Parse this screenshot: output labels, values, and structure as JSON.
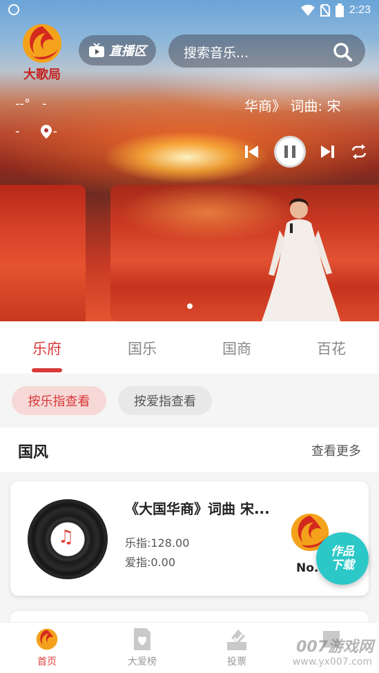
{
  "status_bar": {
    "time": "2:23"
  },
  "header": {
    "logo_text": "大歌局",
    "live_label": "直播区",
    "search_placeholder": "搜索音乐..."
  },
  "weather": {
    "temp": "--°",
    "temp_dash": "-",
    "line2_left": "-",
    "location": "-"
  },
  "now_playing": {
    "marquee": "华商》 词曲: 宋"
  },
  "banner": {
    "active_index": 1
  },
  "tabs": [
    {
      "label": "乐府"
    },
    {
      "label": "国乐"
    },
    {
      "label": "国商"
    },
    {
      "label": "百花"
    }
  ],
  "filters": {
    "by_music": "按乐指查看",
    "by_love": "按爱指查看"
  },
  "section": {
    "title": "国风",
    "more": "查看更多"
  },
  "song_card": {
    "title": "《大国华商》词曲 宋...",
    "music_index": "乐指:128.00",
    "love_index": "爱指:0.00",
    "rank": "No.1"
  },
  "fab": {
    "line1": "作品",
    "line2": "下载"
  },
  "bottom_nav": [
    {
      "label": "首页"
    },
    {
      "label": "大爱榜"
    },
    {
      "label": "投票"
    },
    {
      "label": ""
    }
  ],
  "watermark": {
    "text": "007游戏网",
    "url": "www.yx007.com"
  },
  "colors": {
    "accent": "#d9393a",
    "fab": "#2cc7c7"
  }
}
